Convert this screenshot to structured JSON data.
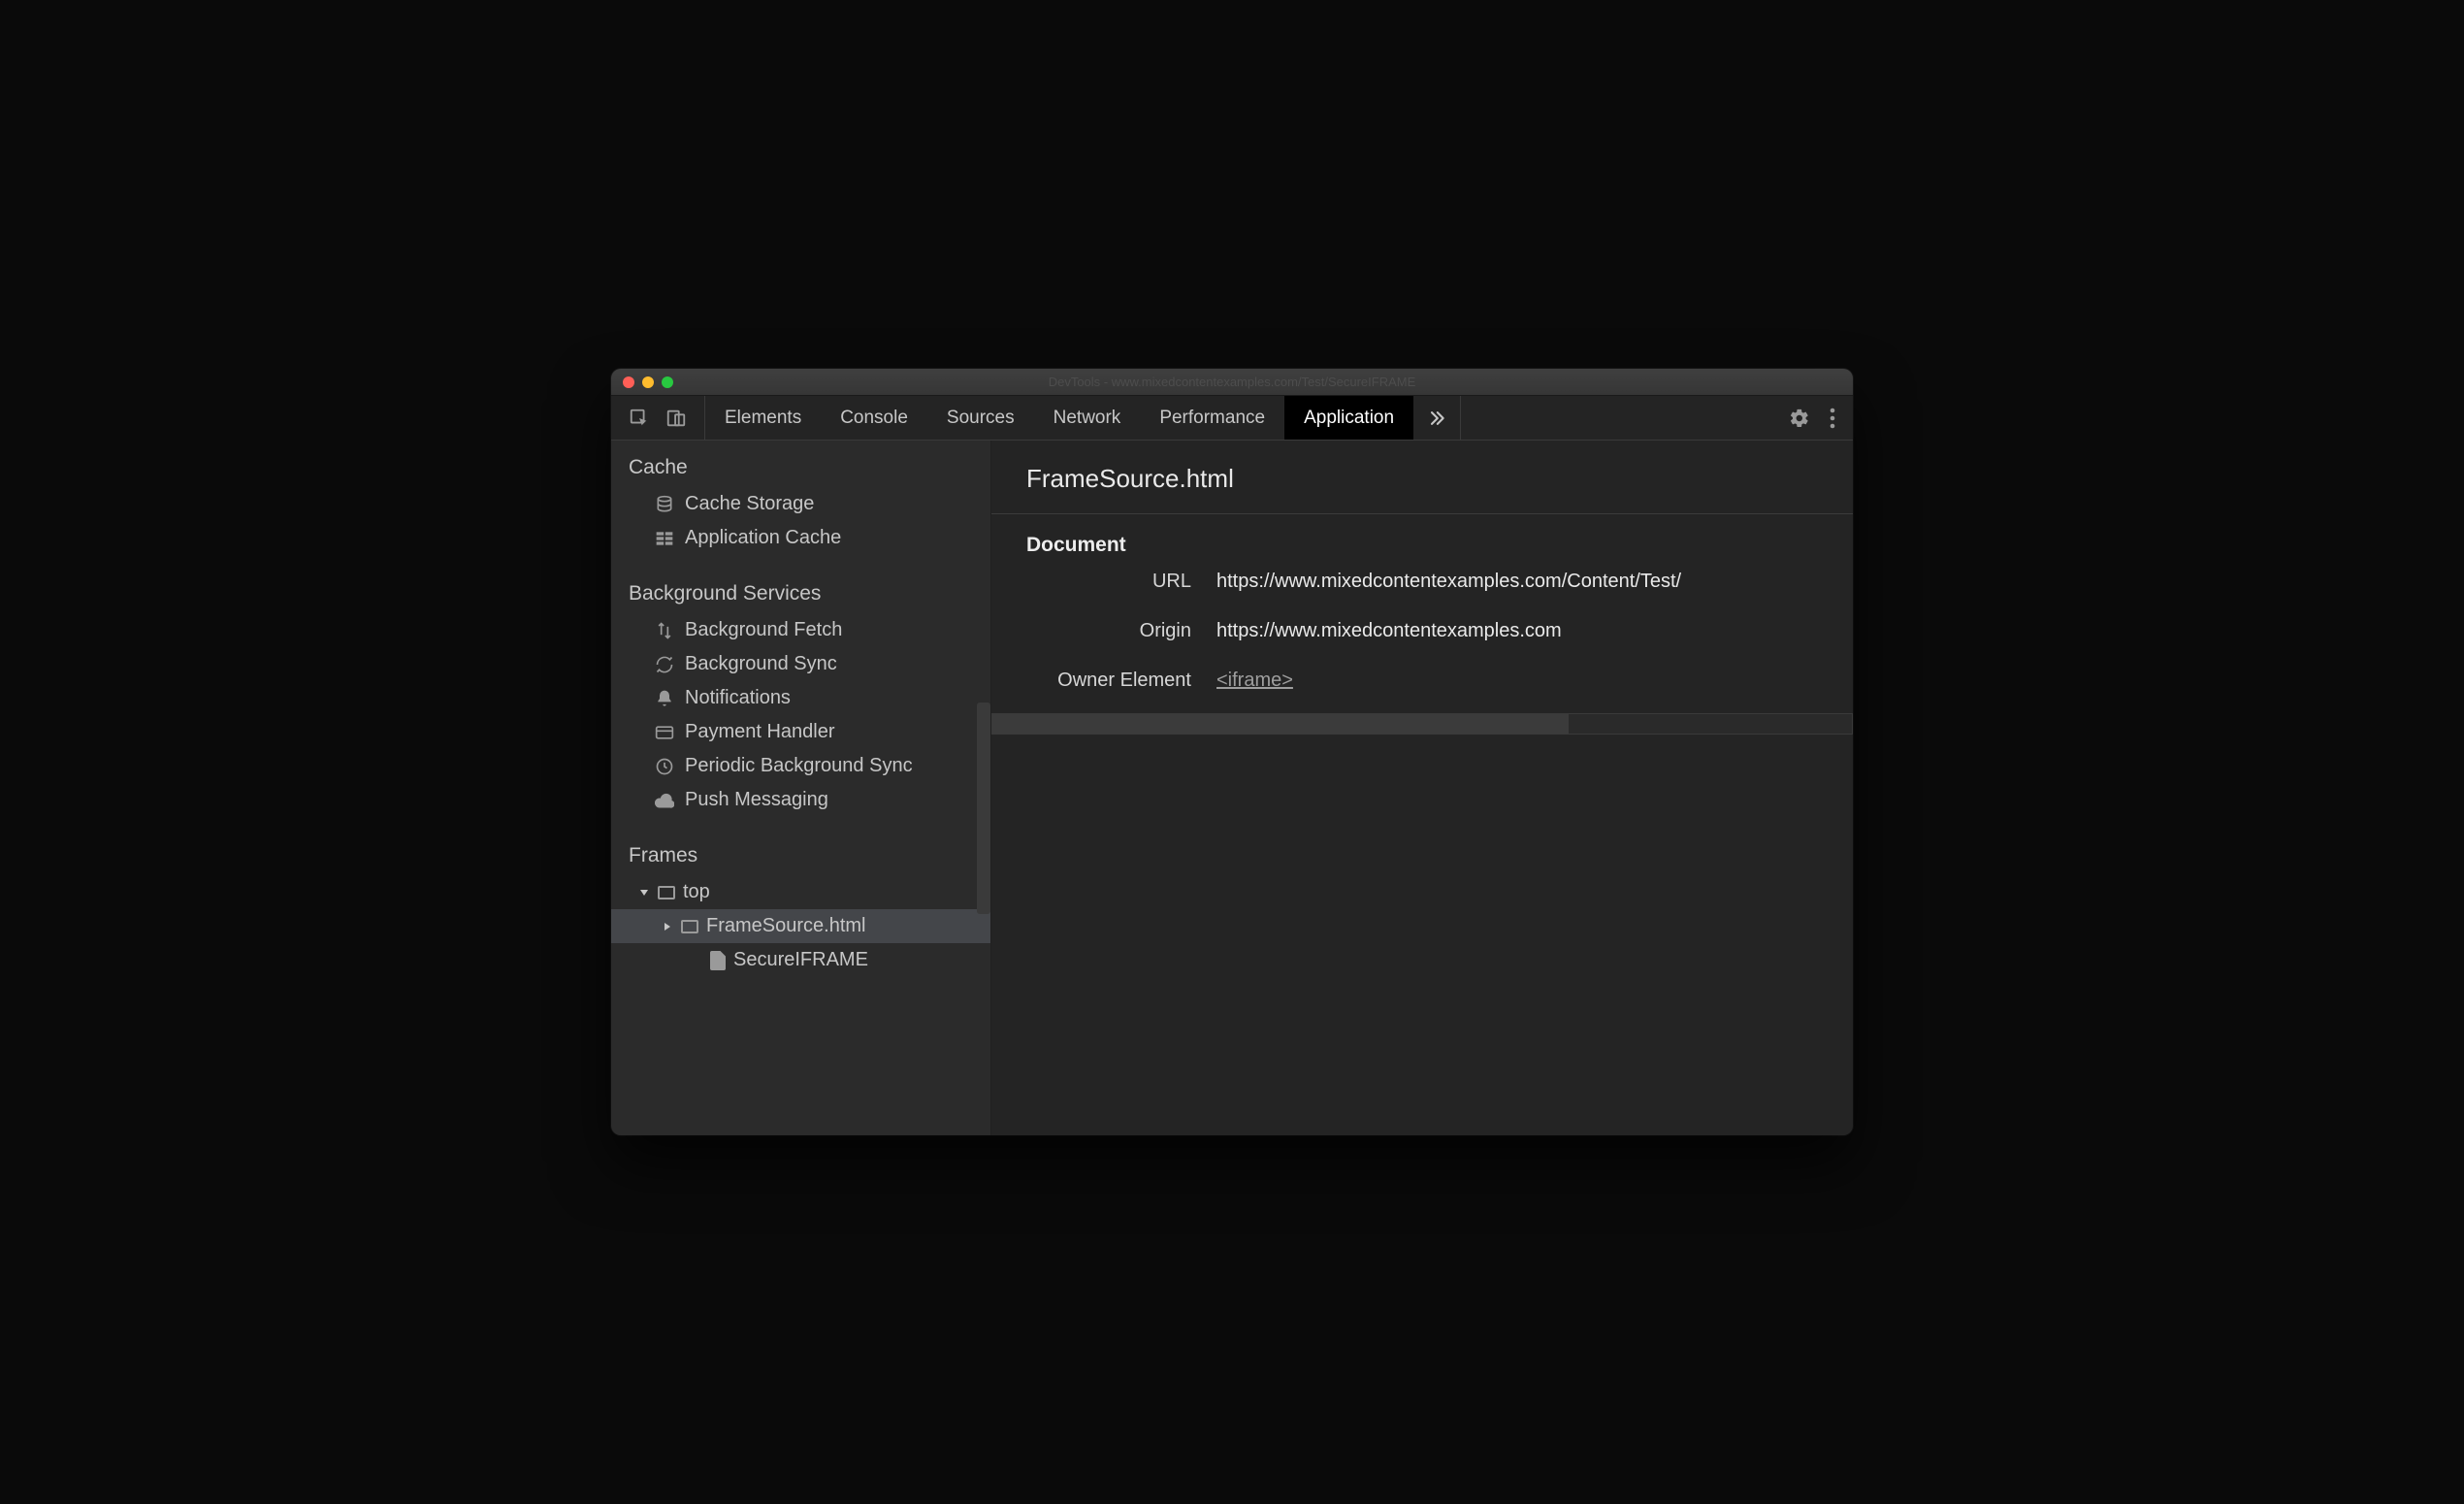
{
  "titlebar": {
    "title": "DevTools - www.mixedcontentexamples.com/Test/SecureIFRAME"
  },
  "tabs": {
    "items": [
      "Elements",
      "Console",
      "Sources",
      "Network",
      "Performance",
      "Application"
    ],
    "active": "Application"
  },
  "sidebar": {
    "cache": {
      "heading": "Cache",
      "items": [
        "Cache Storage",
        "Application Cache"
      ]
    },
    "background": {
      "heading": "Background Services",
      "items": [
        "Background Fetch",
        "Background Sync",
        "Notifications",
        "Payment Handler",
        "Periodic Background Sync",
        "Push Messaging"
      ]
    },
    "frames": {
      "heading": "Frames",
      "top": "top",
      "child": "FrameSource.html",
      "file": "SecureIFRAME"
    }
  },
  "main": {
    "title": "FrameSource.html",
    "section": "Document",
    "url_label": "URL",
    "url_value": "https://www.mixedcontentexamples.com/Content/Test/",
    "origin_label": "Origin",
    "origin_value": "https://www.mixedcontentexamples.com",
    "owner_label": "Owner Element",
    "owner_value": "<iframe>"
  }
}
